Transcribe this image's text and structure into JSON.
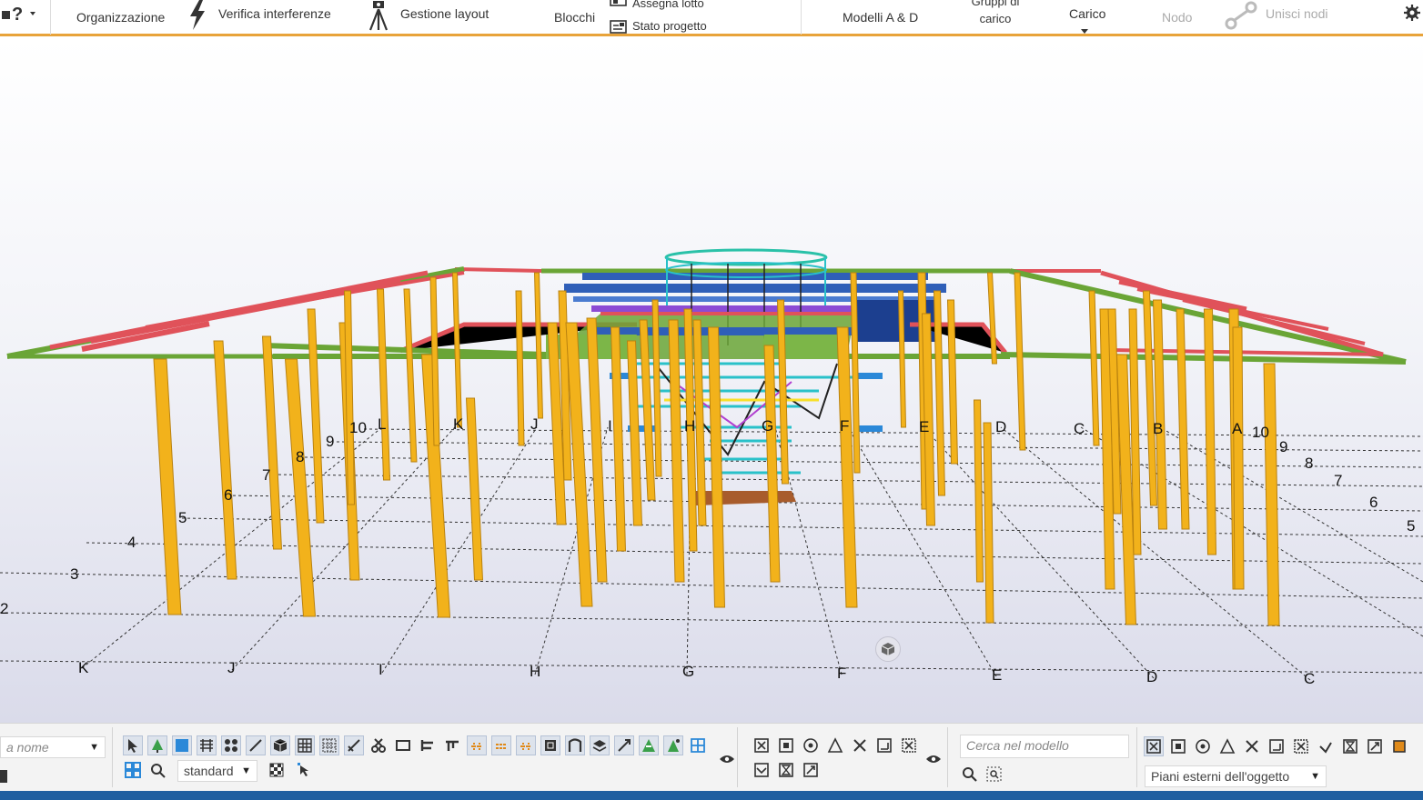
{
  "ribbon": {
    "help_glyph": "?",
    "organizzazione": "Organizzazione",
    "verifica": "Verifica interferenze",
    "gestione": "Gestione layout",
    "blocchi": "Blocchi",
    "assegna": "Assegna lotto",
    "stato": "Stato progetto",
    "modelli": "Modelli A & D",
    "gruppi": "Gruppi di carico",
    "carico": "Carico",
    "nodo": "Nodo",
    "unisci": "Unisci nodi"
  },
  "grid": {
    "letters_front": [
      "K",
      "J",
      "I",
      "H",
      "G",
      "F",
      "E",
      "D",
      "C"
    ],
    "letters_back": [
      "L",
      "K",
      "J",
      "I",
      "H",
      "G",
      "F",
      "E",
      "D",
      "C",
      "B",
      "A"
    ],
    "numbers_left": [
      "2",
      "3",
      "4",
      "5",
      "6",
      "7",
      "8",
      "9",
      "10"
    ],
    "numbers_right": [
      "10",
      "9",
      "8",
      "7",
      "6",
      "5"
    ]
  },
  "bottom": {
    "name_filter": "a nome",
    "selection_mode": "standard",
    "search_placeholder": "Cerca nel modello",
    "snap_planes": "Piani esterni dell'oggetto"
  },
  "colors": {
    "accent": "#e8a33a",
    "status": "#1f5fa0",
    "column": "#f2b21b",
    "beam_green": "#6aa536",
    "beam_red": "#e0525a",
    "beam_blue": "#2f5fb8",
    "cyan": "#29c1c9"
  }
}
